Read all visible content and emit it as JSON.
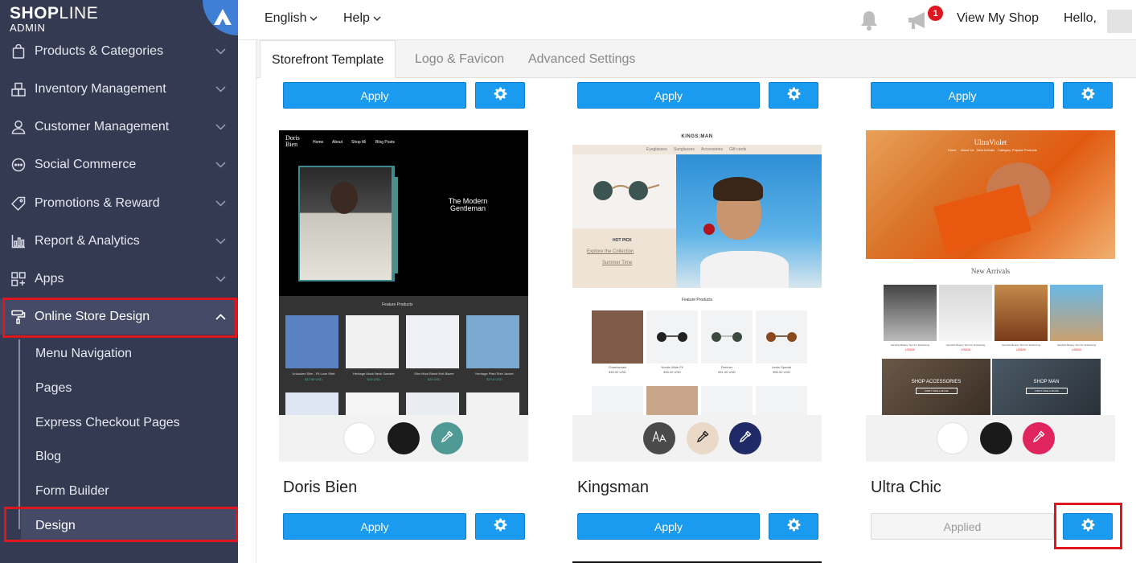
{
  "brand": {
    "logo_bold": "SHOP",
    "logo_thin": "LINE",
    "logo_sub": "ADMIN"
  },
  "sidebar": {
    "items": [
      {
        "label": "Products & Categories",
        "icon": "bag-icon"
      },
      {
        "label": "Inventory Management",
        "icon": "boxes-icon"
      },
      {
        "label": "Customer Management",
        "icon": "person-icon"
      },
      {
        "label": "Social Commerce",
        "icon": "chat-icon"
      },
      {
        "label": "Promotions & Reward",
        "icon": "tag-icon"
      },
      {
        "label": "Report & Analytics",
        "icon": "chart-icon"
      },
      {
        "label": "Apps",
        "icon": "apps-grid-icon"
      },
      {
        "label": "Online Store Design",
        "icon": "paint-roller-icon"
      }
    ],
    "subitems": [
      "Menu Navigation",
      "Pages",
      "Express Checkout Pages",
      "Blog",
      "Form Builder",
      "Design"
    ]
  },
  "topbar": {
    "language": "English",
    "help": "Help",
    "notification_count": "1",
    "view_shop": "View My Shop",
    "greeting": "Hello,"
  },
  "tabs": [
    "Storefront Template",
    "Logo & Favicon",
    "Advanced Settings"
  ],
  "buttons": {
    "apply": "Apply",
    "applied": "Applied"
  },
  "templates": [
    {
      "name": "Doris Bien",
      "preview": {
        "brand": "Doris Bien",
        "nav": [
          "Home",
          "About",
          "Shop All",
          "Blog Posts"
        ],
        "hero_title": "The Modern Gentleman",
        "section": "Feature Products",
        "products": [
          {
            "name": "Untucked Slim - Fit Luxe Shirt",
            "price": "$12.89 USD"
          },
          {
            "name": "Heritage Mock Neck Sweater",
            "price": "$16 USD"
          },
          {
            "name": "Slim Wool Blend Knit Blazer",
            "price": "$29 USD"
          },
          {
            "name": "Heritage Plaid Shirt Jacket",
            "price": "$19.8 USD"
          }
        ]
      },
      "swatches": [
        "#ffffff",
        "#1a1a1a",
        "#4f9a94"
      ]
    },
    {
      "name": "Kingsman",
      "preview": {
        "brand": "KINGS:MAN",
        "nav": [
          "Eyeglasses",
          "Sunglasses",
          "Accessories",
          "Gift cards"
        ],
        "hero_label": "HOT PICK",
        "hero_links": [
          "Explore the Collection",
          "Summer Time"
        ],
        "section": "Feature Products",
        "products": [
          {
            "name": "Chamberlain",
            "price": "¥45.00 USD"
          },
          {
            "name": "Nordic Wide Fit",
            "price": "¥45.00 USD"
          },
          {
            "name": "Fletcher",
            "price": "¥41.00 USD"
          },
          {
            "name": "Lewis Special",
            "price": "¥55.00 USD"
          }
        ]
      },
      "swatches": [
        "#4a4a4a",
        "#ead9c6",
        "#1f2a66"
      ]
    },
    {
      "name": "Ultra Chic",
      "preview": {
        "brand": "UltraViolet",
        "nav": [
          "Home",
          "About Us",
          "New Arrivals",
          "Category",
          "Popular Products"
        ],
        "section": "New Arrivals",
        "products": [
          {
            "name": "Sensible Beauty Tips For Enhancing",
            "price": "US$30"
          },
          {
            "name": "Sensible Beauty Tips For Enhancing",
            "price": "US$30"
          },
          {
            "name": "Sensible Beauty Tips For Enhancing",
            "price": "US$30"
          },
          {
            "name": "Sensible Beauty Tips For Enhancing",
            "price": "US$30"
          }
        ],
        "banners": [
          {
            "title": "SHOP ACCESSORIES",
            "cta": "FIRST TAKE A MOVE"
          },
          {
            "title": "SHOP MAN",
            "cta": "FIRST TAKE A MOVE"
          }
        ]
      },
      "swatches": [
        "#ffffff",
        "#1a1a1a",
        "#e0245e"
      ]
    }
  ],
  "colors": {
    "sidebar": "#343a52",
    "primary": "#1a9bf0",
    "highlight": "#e0161f"
  }
}
